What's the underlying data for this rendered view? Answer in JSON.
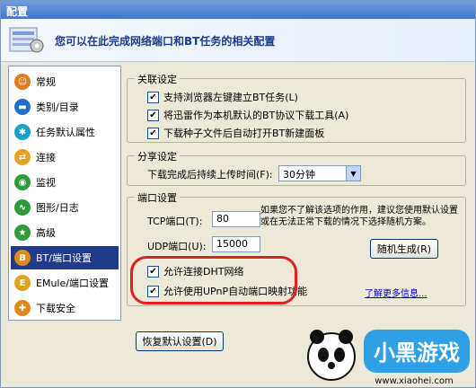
{
  "window": {
    "title": "配置"
  },
  "header": {
    "text": "您可以在此完成网络端口和BT任务的相关配置"
  },
  "sidebar": {
    "items": [
      {
        "label": "常规",
        "icon": "person-icon",
        "color": "#e07a1a"
      },
      {
        "label": "类别/目录",
        "icon": "folder-icon",
        "color": "#1f6fd1"
      },
      {
        "label": "任务默认属性",
        "icon": "gear-icon",
        "color": "#1aa0c8"
      },
      {
        "label": "连接",
        "icon": "connection-icon",
        "color": "#e4a020"
      },
      {
        "label": "监视",
        "icon": "monitor-icon",
        "color": "#2f9a3a"
      },
      {
        "label": "图形/日志",
        "icon": "chart-icon",
        "color": "#2f9a3a"
      },
      {
        "label": "高级",
        "icon": "advanced-icon",
        "color": "#2f9a3a"
      },
      {
        "label": "BT/端口设置",
        "icon": "bt-icon",
        "color": "#e08a1a"
      },
      {
        "label": "EMule/端口设置",
        "icon": "emule-icon",
        "color": "#e0a020"
      },
      {
        "label": "下载安全",
        "icon": "shield-icon",
        "color": "#e08a1a"
      }
    ]
  },
  "association": {
    "title": "关联设定",
    "options": [
      {
        "label": "支持浏览器左键建立BT任务(L)",
        "checked": true
      },
      {
        "label": "将迅雷作为本机默认的BT协议下载工具(A)",
        "checked": true
      },
      {
        "label": "下载种子文件后自动打开BT新建面板",
        "checked": true
      }
    ]
  },
  "share": {
    "title": "分享设定",
    "label": "下载完成后持续上传时间(F):",
    "value": "30分钟"
  },
  "port": {
    "title": "端口设置",
    "tcp_label": "TCP端口(T):",
    "tcp_value": "80",
    "udp_label": "UDP端口(U):",
    "udp_value": "15000",
    "note": "如果您不了解该选项的作用，建议您使用默认设置或在无法正常下载的情况下选择随机方案。",
    "random_button": "随机生成(R)",
    "dht_label": "允许连接DHT网络",
    "dht_checked": true,
    "upnp_label": "允许使用UPnP自动端口映射功能",
    "upnp_checked": true,
    "more_link": "了解更多信息..."
  },
  "restore_button": "恢复默认设置(D)",
  "watermark": {
    "title": "小黑游戏",
    "url": "www.xiaohei.com"
  }
}
